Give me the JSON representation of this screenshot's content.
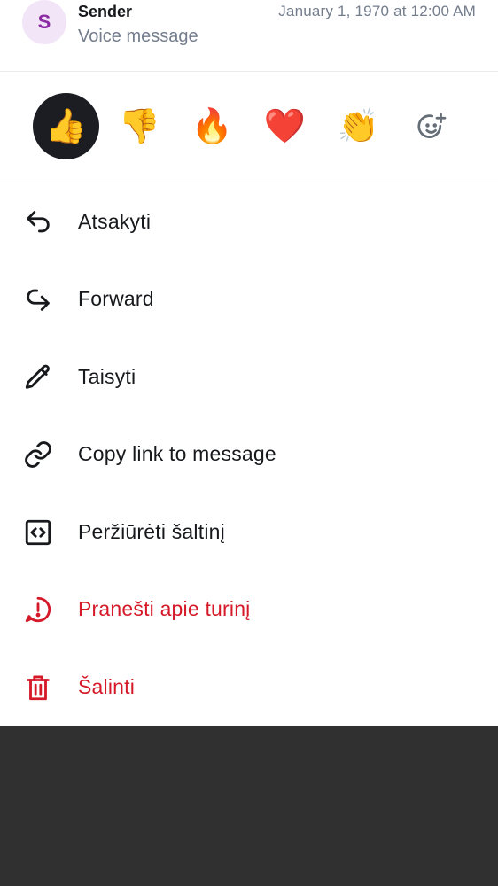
{
  "header": {
    "avatar_letter": "S",
    "sender": "Sender",
    "timestamp": "January 1, 1970 at 12:00 AM",
    "preview": "Voice message"
  },
  "reactions": [
    {
      "emoji": "👍",
      "name": "thumbs-up",
      "selected": true
    },
    {
      "emoji": "👎",
      "name": "thumbs-down",
      "selected": false
    },
    {
      "emoji": "🔥",
      "name": "fire",
      "selected": false
    },
    {
      "emoji": "❤️",
      "name": "heart",
      "selected": false
    },
    {
      "emoji": "👏",
      "name": "clap",
      "selected": false
    },
    {
      "icon": "add-reaction-icon",
      "selected": false
    }
  ],
  "menu": {
    "reply": "Atsakyti",
    "forward": "Forward",
    "edit": "Taisyti",
    "copy_link": "Copy link to message",
    "view_source": "Peržiūrėti šaltinį",
    "report": "Pranešti apie turinį",
    "delete": "Šalinti"
  },
  "colors": {
    "danger": "#d51928",
    "text": "#17191c",
    "secondary": "#737d8c",
    "avatar_bg": "#f3e5f8",
    "avatar_fg": "#8b2ba4",
    "selected_reaction_bg": "#1b1d22",
    "scrim": "#303030"
  }
}
